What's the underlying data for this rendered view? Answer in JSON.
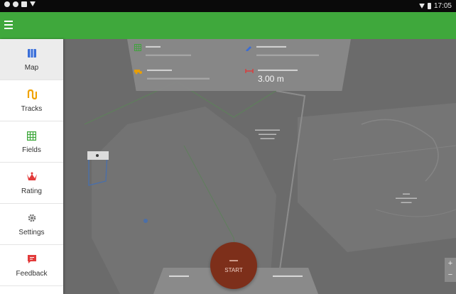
{
  "status_bar": {
    "left_icons": [
      "location-icon",
      "notification-icon",
      "cast-icon",
      "wifi-icon"
    ],
    "time": "17:05"
  },
  "nav": {
    "items": [
      {
        "label": "Map",
        "icon": "map-icon",
        "color": "#3b6fd8",
        "active": true
      },
      {
        "label": "Tracks",
        "icon": "tracks-icon",
        "color": "#f0a200"
      },
      {
        "label": "Fields",
        "icon": "fields-icon",
        "color": "#3fa83c"
      },
      {
        "label": "Rating",
        "icon": "rating-icon",
        "color": "#e23a3a"
      },
      {
        "label": "Settings",
        "icon": "gear-icon",
        "color": "#6d6d6d"
      },
      {
        "label": "Feedback",
        "icon": "feedback-icon",
        "color": "#e23a3a"
      }
    ]
  },
  "stats": {
    "implement_width_value": "3.00 m"
  },
  "colors": {
    "appbar": "#3fa83c",
    "start_button": "#7d2f1a",
    "map_overlay": "#6d6d6d"
  },
  "start_button": {
    "label": "START"
  }
}
